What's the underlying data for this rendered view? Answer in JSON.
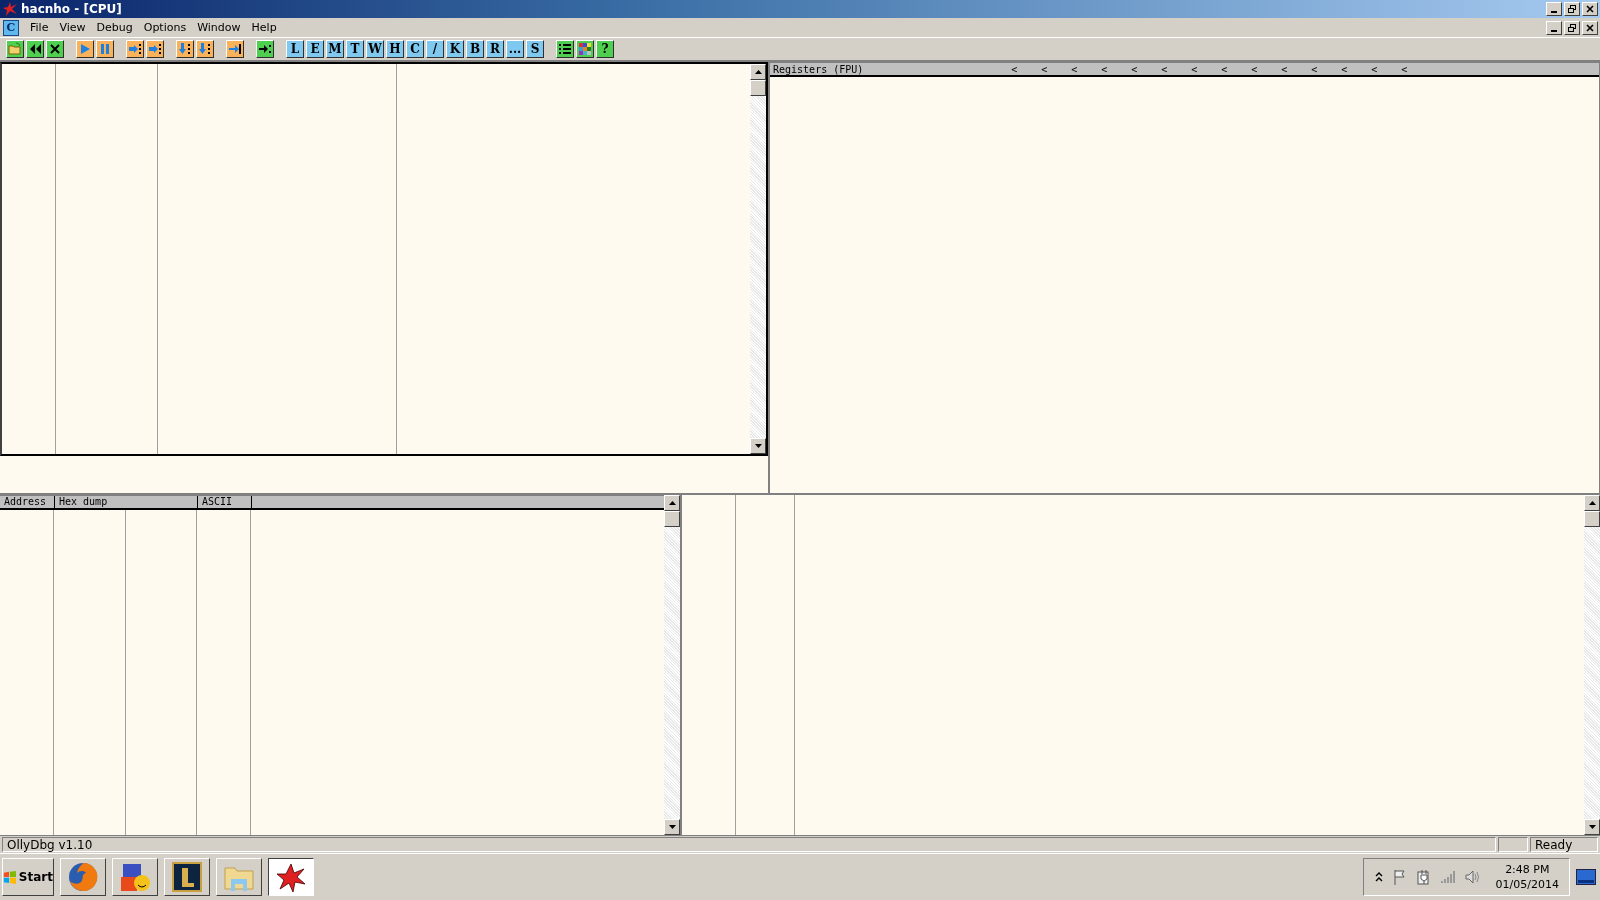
{
  "window": {
    "title": "hacnho - [CPU]"
  },
  "menu": [
    {
      "label": "File"
    },
    {
      "label": "View"
    },
    {
      "label": "Debug"
    },
    {
      "label": "Options"
    },
    {
      "label": "Window"
    },
    {
      "label": "Help"
    }
  ],
  "menu_icon": "C",
  "toolbar": [
    [
      {
        "kind": "open",
        "color": "#4fcf4f"
      },
      {
        "kind": "rewind",
        "color": "#4fcf4f"
      },
      {
        "kind": "close",
        "color": "#4fcf4f"
      }
    ],
    [
      {
        "kind": "run",
        "color": "#f9b25a"
      },
      {
        "kind": "pause",
        "color": "#f9b25a"
      }
    ],
    [
      {
        "kind": "step-in",
        "color": "#f9b25a"
      },
      {
        "kind": "step-over",
        "color": "#f9b25a"
      }
    ],
    [
      {
        "kind": "trace-in",
        "color": "#f9b25a"
      },
      {
        "kind": "trace-over",
        "color": "#f9b25a"
      }
    ],
    [
      {
        "kind": "till-return",
        "color": "#f9b25a"
      }
    ],
    [
      {
        "kind": "goto",
        "color": "#4fcf4f"
      }
    ],
    [
      {
        "kind": "letter",
        "label": "L",
        "color": "#7fc8f0"
      },
      {
        "kind": "letter",
        "label": "E",
        "color": "#7fc8f0"
      },
      {
        "kind": "letter",
        "label": "M",
        "color": "#7fc8f0"
      },
      {
        "kind": "letter",
        "label": "T",
        "color": "#7fc8f0"
      },
      {
        "kind": "letter",
        "label": "W",
        "color": "#7fc8f0"
      },
      {
        "kind": "letter",
        "label": "H",
        "color": "#7fc8f0"
      },
      {
        "kind": "letter",
        "label": "C",
        "color": "#7fc8f0"
      },
      {
        "kind": "letter",
        "label": "/",
        "color": "#7fc8f0"
      },
      {
        "kind": "letter",
        "label": "K",
        "color": "#7fc8f0"
      },
      {
        "kind": "letter",
        "label": "B",
        "color": "#7fc8f0"
      },
      {
        "kind": "letter",
        "label": "R",
        "color": "#7fc8f0"
      },
      {
        "kind": "letter",
        "label": "...",
        "color": "#7fc8f0"
      },
      {
        "kind": "letter",
        "label": "S",
        "color": "#7fc8f0"
      }
    ],
    [
      {
        "kind": "list",
        "color": "#4fcf4f"
      },
      {
        "kind": "palette",
        "color": "#4fcf4f"
      },
      {
        "kind": "letter",
        "label": "?",
        "color": "#4fcf4f"
      }
    ]
  ],
  "registers": {
    "title": "Registers (FPU)",
    "arrows": [
      "<",
      "<",
      "<",
      "<",
      "<",
      "<",
      "<",
      "<",
      "<",
      "<",
      "<",
      "<",
      "<",
      "<"
    ]
  },
  "dump": {
    "columns": [
      "Address",
      "Hex dump",
      "ASCII"
    ]
  },
  "status_bar": {
    "message": "OllyDbg v1.10",
    "state": "Ready"
  },
  "taskbar": {
    "start": "Start",
    "apps": [
      {
        "kind": "browser",
        "selected": false
      },
      {
        "kind": "messenger",
        "selected": false
      },
      {
        "kind": "game",
        "selected": false
      },
      {
        "kind": "folder",
        "selected": false
      },
      {
        "kind": "debugger",
        "selected": true
      }
    ],
    "time": "2:48 PM",
    "date": "01/05/2014"
  }
}
